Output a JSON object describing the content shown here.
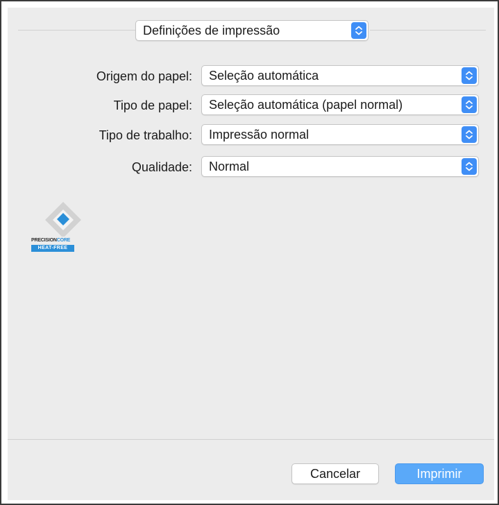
{
  "header": {
    "panel_select": "Definições de impressão"
  },
  "settings": [
    {
      "label": "Origem do papel:",
      "value": "Seleção automática"
    },
    {
      "label": "Tipo de papel:",
      "value": "Seleção automática (papel normal)"
    },
    {
      "label": "Tipo de trabalho:",
      "value": "Impressão normal"
    },
    {
      "label": "Qualidade:",
      "value": "Normal"
    }
  ],
  "logo": {
    "line1_a": "PRECISION",
    "line1_b": "CORE",
    "line2": "HEAT-FREE"
  },
  "footer": {
    "cancel_label": "Cancelar",
    "print_label": "Imprimir"
  },
  "colors": {
    "accent": "#3f8ef6",
    "print_button": "#5aa9f9",
    "panel_background": "#ececec"
  },
  "icons": {
    "stepper": "up-down-chevron-icon",
    "logo": "precisioncore-diamond-icon"
  }
}
